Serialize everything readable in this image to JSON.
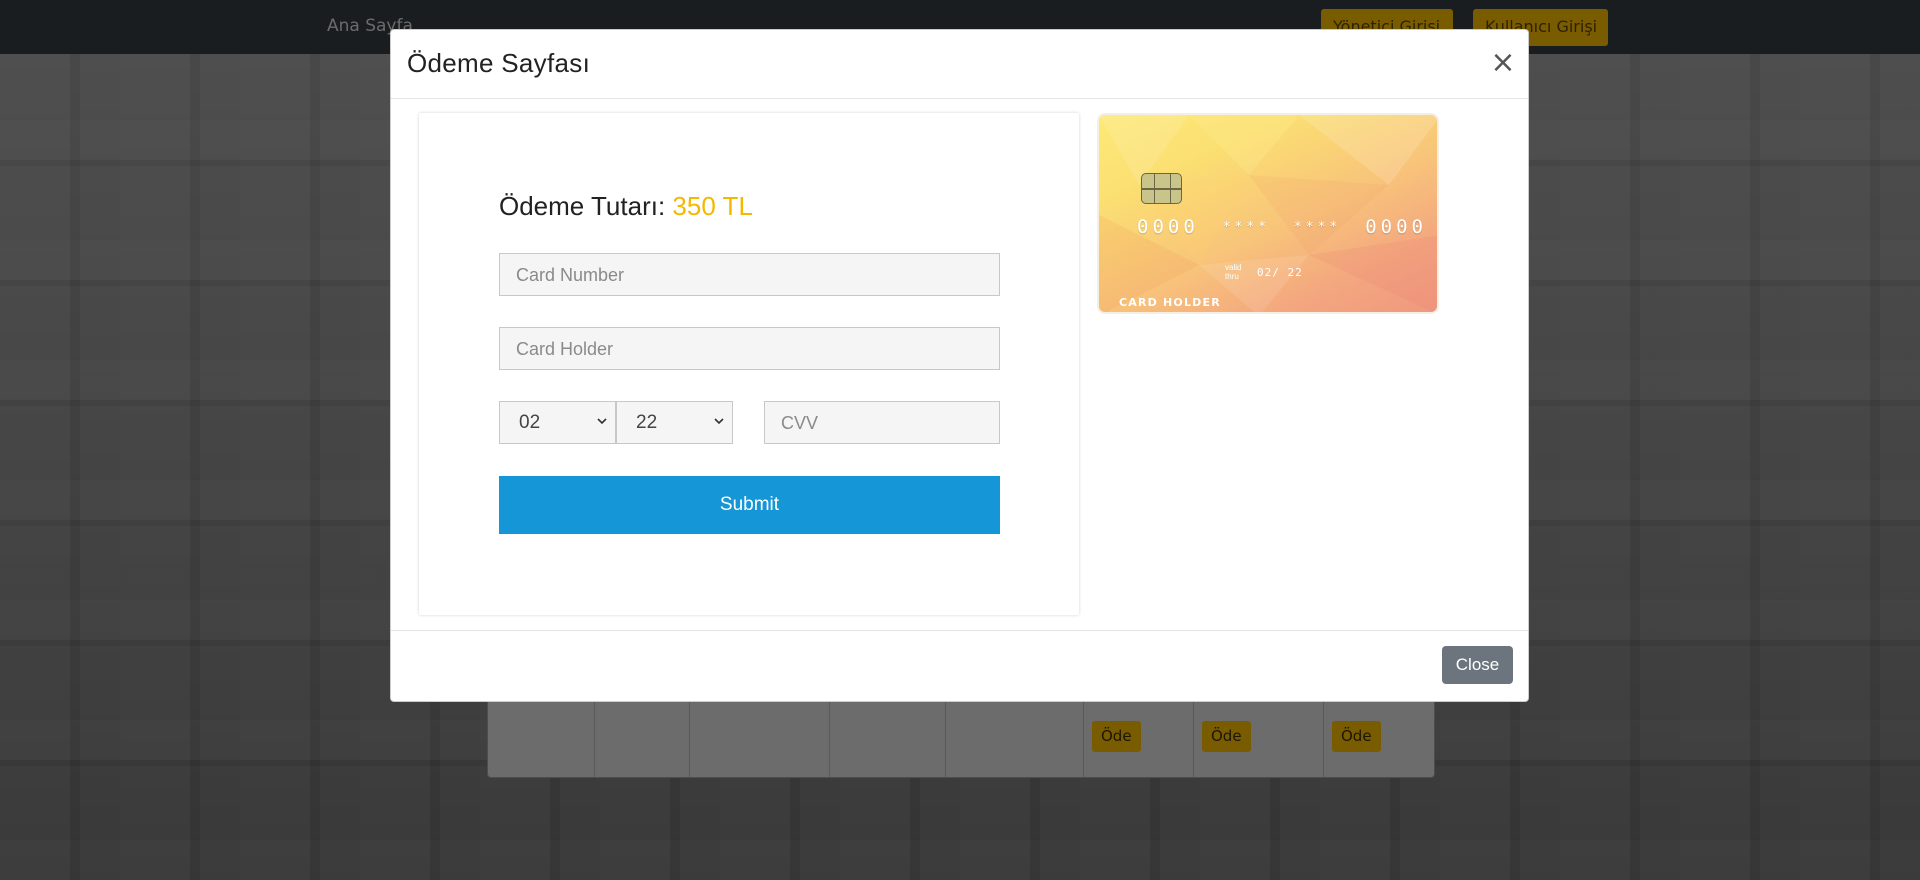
{
  "background": {
    "navbar": {
      "home_link": "Ana Sayfa",
      "admin_login": "Yönetici Girişi",
      "user_login": "Kullanıcı Girişi",
      "button_color": "#f5b800"
    },
    "table": {
      "pay_buttons": [
        "Öde",
        "Öde",
        "Öde"
      ]
    }
  },
  "modal": {
    "title": "Ödeme Sayfası",
    "close_icon": "×",
    "amount_label": "Ödeme Tutarı:",
    "amount_value": "350 TL",
    "card_number_placeholder": "Card Number",
    "card_holder_placeholder": "Card Holder",
    "month_value": "02",
    "year_value": "22",
    "cvv_placeholder": "CVV",
    "submit_label": "Submit",
    "close_button": "Close",
    "colors": {
      "accent": "#f5b800",
      "submit": "#1596d6",
      "close_button": "#6c757d"
    }
  },
  "card_preview": {
    "number_groups": [
      "0000",
      "****",
      "****",
      "0000"
    ],
    "valid_label_1": "valid",
    "valid_label_2": "thru",
    "expiry": "02/ 22",
    "holder": "CARD HOLDER",
    "chip_icon": "chip-icon"
  }
}
